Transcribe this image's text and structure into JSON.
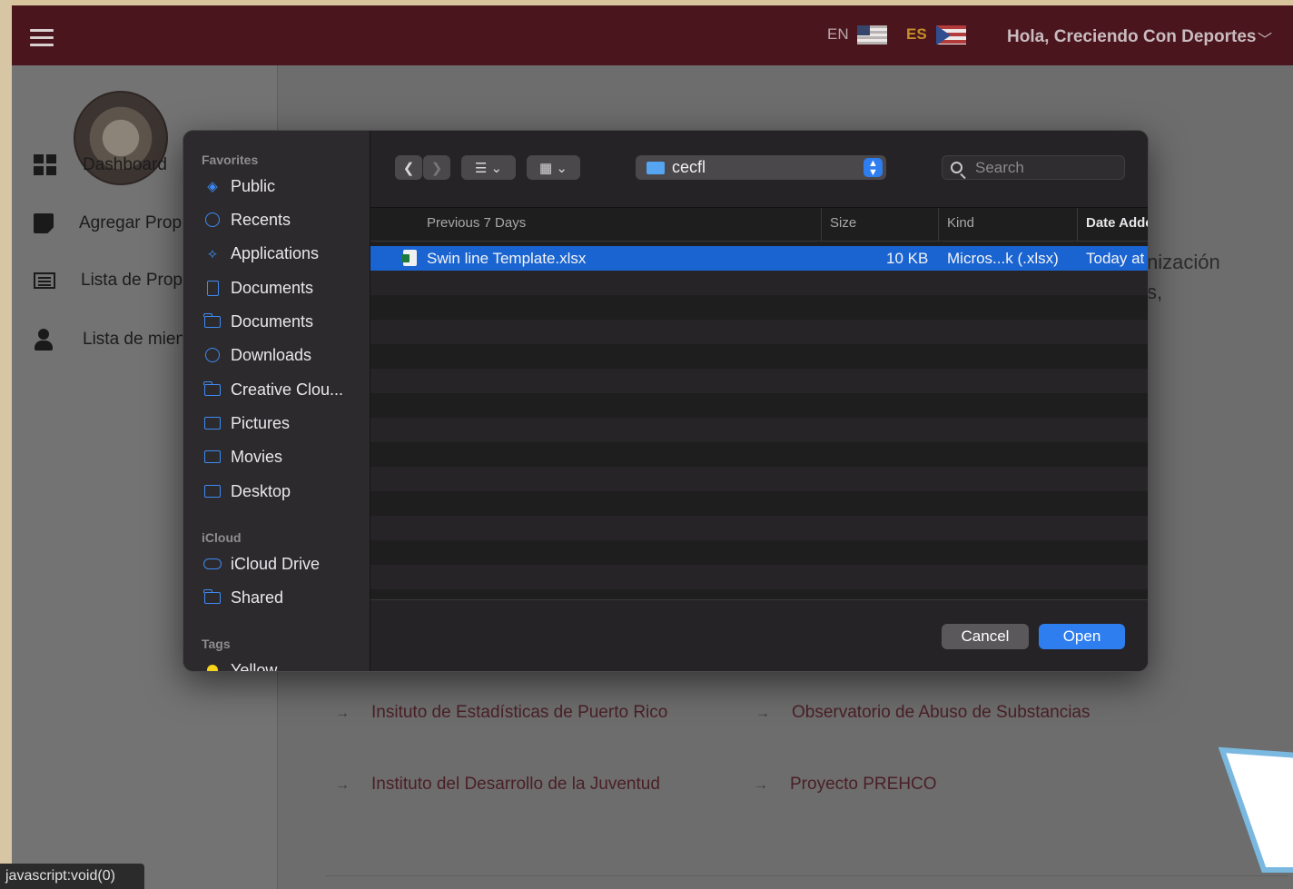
{
  "page": {
    "lang_en": "EN",
    "lang_es": "ES",
    "greeting": "Hola, Creciendo Con Deportes",
    "sidebar": [
      {
        "label": "Dashboard",
        "icon": "dashboard-icon"
      },
      {
        "label": "Agregar Prop",
        "icon": "note-icon"
      },
      {
        "label": "Lista de Propu",
        "icon": "list-icon"
      },
      {
        "label": "Lista de mien",
        "icon": "user-icon"
      }
    ],
    "bg_text_1": "nización",
    "bg_text_2": "s,",
    "links": [
      "Insituto de Estadísticas de Puerto Rico",
      "Observatorio de Abuso de Substancias",
      "Instituto del Desarrollo de la Juventud",
      "Proyecto PREHCO"
    ],
    "status_url": "javascript:void(0)"
  },
  "dialog": {
    "sections": {
      "favorites": "Favorites",
      "icloud": "iCloud",
      "tags": "Tags"
    },
    "favorites": [
      "Public",
      "Recents",
      "Applications",
      "Documents",
      "Documents",
      "Downloads",
      "Creative Clou...",
      "Pictures",
      "Movies",
      "Desktop"
    ],
    "icloud": [
      "iCloud Drive",
      "Shared"
    ],
    "tags": [
      "Yellow"
    ],
    "location": "cecfl",
    "search_placeholder": "Search",
    "columns": {
      "name": "Previous 7 Days",
      "size": "Size",
      "kind": "Kind",
      "date": "Date Adde"
    },
    "file": {
      "name": "Swin line Template.xlsx",
      "size": "10 KB",
      "kind": "Micros...k (.xlsx)",
      "date": "Today at"
    },
    "cancel": "Cancel",
    "open": "Open",
    "accent": "#2e7ef0",
    "selection": "#1a64d2"
  }
}
